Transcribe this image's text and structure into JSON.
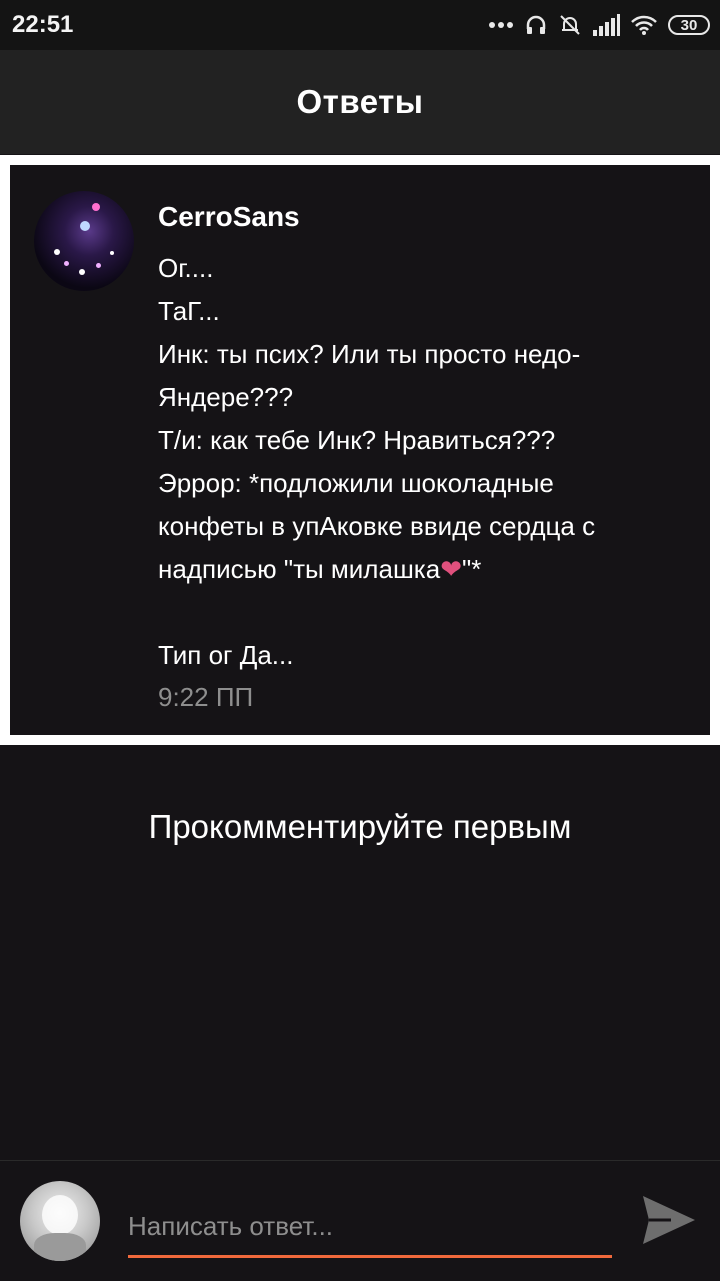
{
  "status_bar": {
    "time": "22:51",
    "battery": "30",
    "icons": [
      "more-dots-icon",
      "headphones-icon",
      "bell-muted-icon",
      "signal-icon",
      "wifi-icon",
      "battery-icon"
    ]
  },
  "header": {
    "title": "Ответы"
  },
  "post": {
    "author": "CerroSans",
    "lines": [
      "Ог....",
      "ТаГ...",
      "Инк: ты псих? Или ты просто недо-",
      "Яндере???",
      "Т/и: как тебе Инк? Нравиться???",
      "Эррор: *подложили шоколадные",
      "конфеты в упАковке ввиде сердца с",
      "надписью \"ты милашка"
    ],
    "heart_emoji": "❤",
    "line_end": "\"*",
    "closing": "Тип ог Да...",
    "time": "9:22 ПП"
  },
  "empty_state": "Прокомментируйте первым",
  "reply": {
    "placeholder": "Написать ответ...",
    "accent_color": "#f0693c"
  }
}
